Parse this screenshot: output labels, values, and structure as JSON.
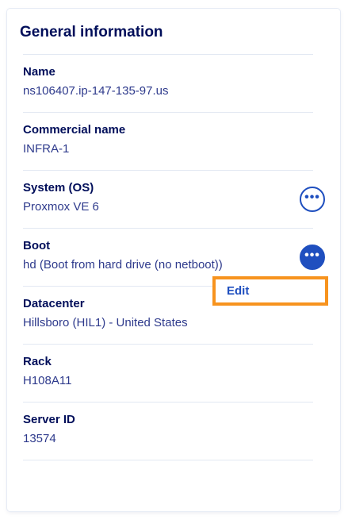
{
  "card": {
    "title": "General information",
    "fields": [
      {
        "label": "Name",
        "value": "ns106407.ip-147-135-97.us"
      },
      {
        "label": "Commercial name",
        "value": "INFRA-1"
      },
      {
        "label": "System (OS)",
        "value": "Proxmox VE 6"
      },
      {
        "label": "Boot",
        "value": "hd (Boot from hard drive (no netboot))"
      },
      {
        "label": "Datacenter",
        "value": "Hillsboro (HIL1) - United States"
      },
      {
        "label": "Rack",
        "value": "H108A11"
      },
      {
        "label": "Server ID",
        "value": "13574"
      }
    ],
    "os_menu_icon": "more-options-icon",
    "boot_menu_icon": "more-options-icon",
    "boot_menu": {
      "items": [
        "Edit"
      ]
    }
  },
  "colors": {
    "accent": "#1f4fbf",
    "highlight": "#f7931e",
    "title": "#000e5a"
  }
}
